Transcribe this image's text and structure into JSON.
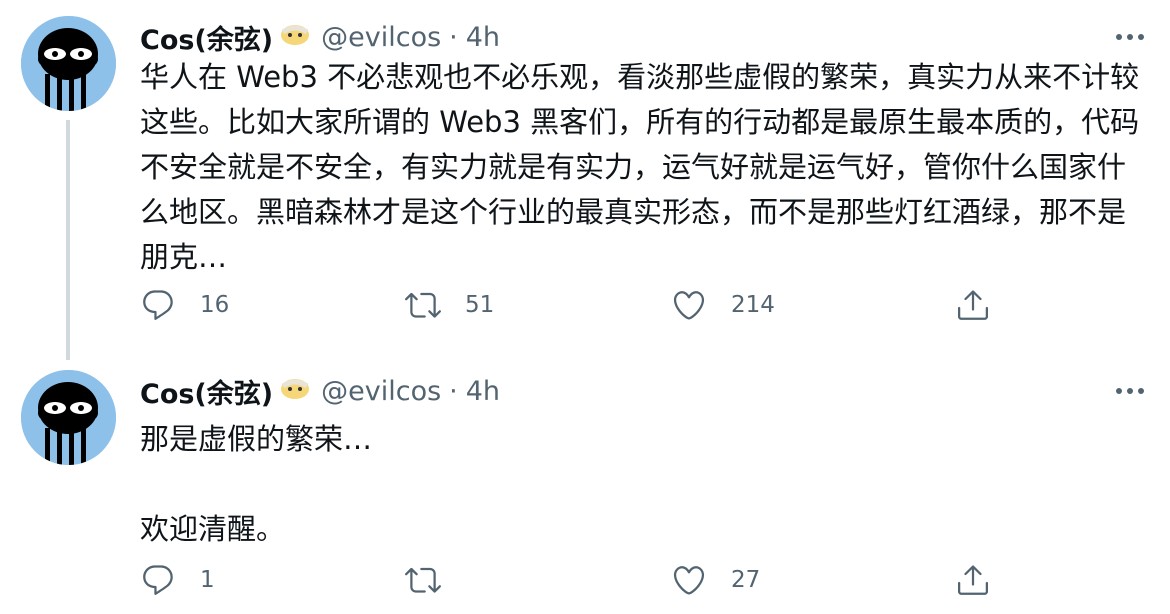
{
  "tweets": [
    {
      "name": "Cos(余弦)",
      "handle": "@evilcos",
      "separator": "·",
      "time": "4h",
      "text": "华人在 Web3 不必悲观也不必乐观，看淡那些虚假的繁荣，真实力从来不计较这些。比如大家所谓的 Web3 黑客们，所有的行动都是最原生最本质的，代码不安全就是不安全，有实力就是有实力，运气好就是运气好，管你什么国家什么地区。黑暗森林才是这个行业的最真实形态，而不是那些灯红酒绿，那不是朋克…",
      "replies": "16",
      "retweets": "51",
      "likes": "214"
    },
    {
      "name": "Cos(余弦)",
      "handle": "@evilcos",
      "separator": "·",
      "time": "4h",
      "text": "那是虚假的繁荣…\n\n欢迎清醒。",
      "replies": "1",
      "retweets": "",
      "likes": "27"
    }
  ],
  "icons": {
    "more": "more-horizontal-icon",
    "reply": "reply-icon",
    "retweet": "retweet-icon",
    "like": "heart-icon",
    "share": "share-icon",
    "badge": "emoji-badge-icon"
  },
  "colors": {
    "text": "#0f1419",
    "secondary": "#536471",
    "thread_line": "#cfd9de",
    "avatar_bg": "#8ec1ea"
  }
}
